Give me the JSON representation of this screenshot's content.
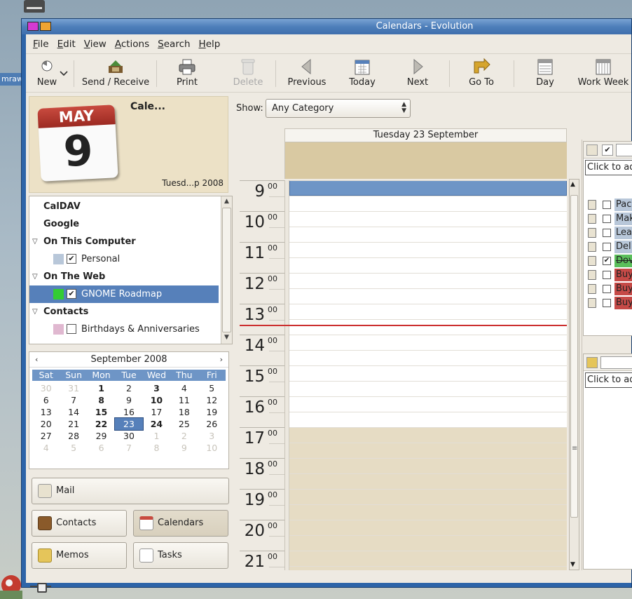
{
  "desktop": {
    "left_label": "mraw"
  },
  "window": {
    "title": "Calendars - Evolution"
  },
  "menu": [
    "File",
    "Edit",
    "View",
    "Actions",
    "Search",
    "Help"
  ],
  "toolbar": {
    "new": "New",
    "send_receive": "Send / Receive",
    "print": "Print",
    "delete": "Delete",
    "previous": "Previous",
    "today": "Today",
    "next": "Next",
    "goto": "Go To",
    "day": "Day",
    "work_week": "Work Week"
  },
  "header": {
    "icon_month": "MAY",
    "icon_day": "9",
    "title": "Cale...",
    "date": "Tuesd...p 2008"
  },
  "sources": {
    "caldav": "CalDAV",
    "google": "Google",
    "on_this_computer": "On This Computer",
    "personal": "Personal",
    "on_the_web": "On The Web",
    "gnome_roadmap": "GNOME Roadmap",
    "contacts": "Contacts",
    "birthdays": "Birthdays & Anniversaries",
    "colors": {
      "personal": "#b8c7d9",
      "gnome_roadmap": "#33cc33",
      "birthdays": "#e0b8d0"
    }
  },
  "minical": {
    "prev": "‹",
    "next": "›",
    "month": "September 2008",
    "dow": [
      "Sat",
      "Sun",
      "Mon",
      "Tue",
      "Wed",
      "Thu",
      "Fri"
    ],
    "days": [
      [
        "30",
        "31",
        "1",
        "2",
        "3",
        "4",
        "5"
      ],
      [
        "6",
        "7",
        "8",
        "9",
        "10",
        "11",
        "12"
      ],
      [
        "13",
        "14",
        "15",
        "16",
        "17",
        "18",
        "19"
      ],
      [
        "20",
        "21",
        "22",
        "23",
        "24",
        "25",
        "26"
      ],
      [
        "27",
        "28",
        "29",
        "30",
        "1",
        "2",
        "3"
      ],
      [
        "4",
        "5",
        "6",
        "7",
        "8",
        "9",
        "10"
      ]
    ]
  },
  "switcher": {
    "mail": "Mail",
    "contacts": "Contacts",
    "calendars": "Calendars",
    "memos": "Memos",
    "tasks": "Tasks"
  },
  "dayview": {
    "show_label": "Show:",
    "category": "Any Category",
    "date_header": "Tuesday 23 September",
    "hours": [
      "9",
      "10",
      "11",
      "12",
      "13",
      "14",
      "15",
      "16",
      "17",
      "18",
      "19",
      "20",
      "21"
    ],
    "minutes": "00"
  },
  "tasks": {
    "click_to_add": "Click to ad",
    "items": [
      {
        "text": "Pac",
        "done": false,
        "color": "#b8c7d9"
      },
      {
        "text": "Mak",
        "done": false,
        "color": "#b8c7d9"
      },
      {
        "text": "Lea",
        "done": false,
        "color": "#b8c7d9"
      },
      {
        "text": "Del",
        "done": false,
        "color": "#b8c7d9"
      },
      {
        "text": "Dov",
        "done": true,
        "color": "#5bbf5b"
      },
      {
        "text": "Buy",
        "done": false,
        "color": "#c64a47"
      },
      {
        "text": "Buy",
        "done": false,
        "color": "#c64a47"
      },
      {
        "text": "Buy",
        "done": false,
        "color": "#c64a47"
      }
    ]
  },
  "memos": {
    "click_to_add": "Click to ad"
  }
}
